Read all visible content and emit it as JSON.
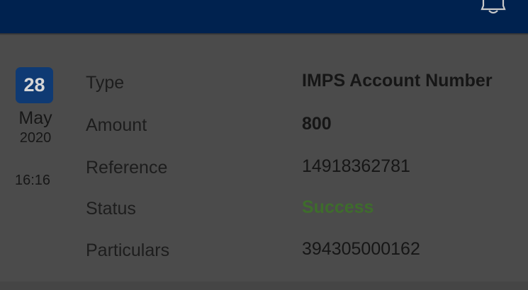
{
  "header": {
    "icon": "bell-icon",
    "background": "#00224f"
  },
  "date": {
    "day": "28",
    "month": "May",
    "year": "2020",
    "time": "16:16"
  },
  "details": {
    "type": {
      "label": "Type",
      "value": "IMPS Account Number"
    },
    "amount": {
      "label": "Amount",
      "value": "800"
    },
    "reference": {
      "label": "Reference",
      "value": "14918362781"
    },
    "status": {
      "label": "Status",
      "value": "Success",
      "color": "#3e6c2c"
    },
    "particulars": {
      "label": "Particulars",
      "value": "394305000162"
    }
  }
}
